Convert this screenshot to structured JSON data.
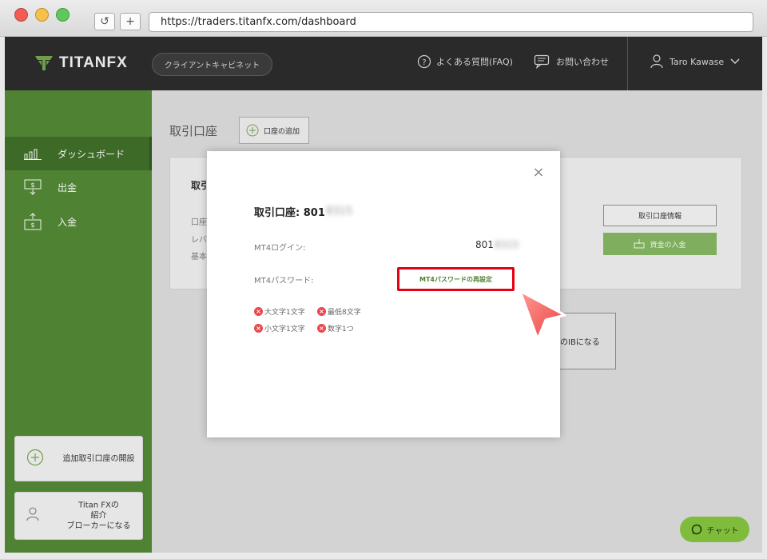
{
  "browser": {
    "url": "https://traders.titanfx.com/dashboard",
    "reload_icon": "↺",
    "newtab_icon": "+"
  },
  "header": {
    "logo_text": "TITANFX",
    "client_portal": "クライアントキャビネット",
    "faq": "よくある質問(FAQ)",
    "contact": "お問い合わせ",
    "user_name": "Taro Kawase"
  },
  "sidebar": {
    "items": [
      {
        "label": "ダッシュボード",
        "icon": "chart-bars-icon",
        "active": true
      },
      {
        "label": "出金",
        "icon": "withdraw-icon",
        "active": false
      },
      {
        "label": "入金",
        "icon": "deposit-icon",
        "active": false
      }
    ],
    "card_open_account": "追加取引口座の開設",
    "card_ib_line1": "Titan FXの",
    "card_ib_line2": "紹介",
    "card_ib_line3": "ブローカーになる"
  },
  "main": {
    "title": "取引口座",
    "add_account": "口座の追加",
    "account_card": {
      "name_partial": "取引",
      "field1": "口座",
      "field2": "レバ",
      "field3": "基本"
    },
    "account_info_button": "取引口座情報",
    "deposit_button": "資金の入金",
    "ib_card_text": "のIBになる",
    "chat_button": "チャット"
  },
  "modal": {
    "title_prefix": "取引口座: 801",
    "title_blurred": "8315",
    "login_label": "MT4ログイン:",
    "login_prefix": "801",
    "login_blurred": "8315",
    "password_label": "MT4パスワード:",
    "reset_button": "MT4パスワードの再設定",
    "rules": [
      "大文字1文字",
      "最低8文字",
      "小文字1文字",
      "数字1つ"
    ],
    "close_icon": "×"
  },
  "colors": {
    "sidebar_green": "#4f8233",
    "accent_green": "#7fae5e",
    "highlight_red": "#e60012",
    "header_dark": "#2a2a2a"
  }
}
